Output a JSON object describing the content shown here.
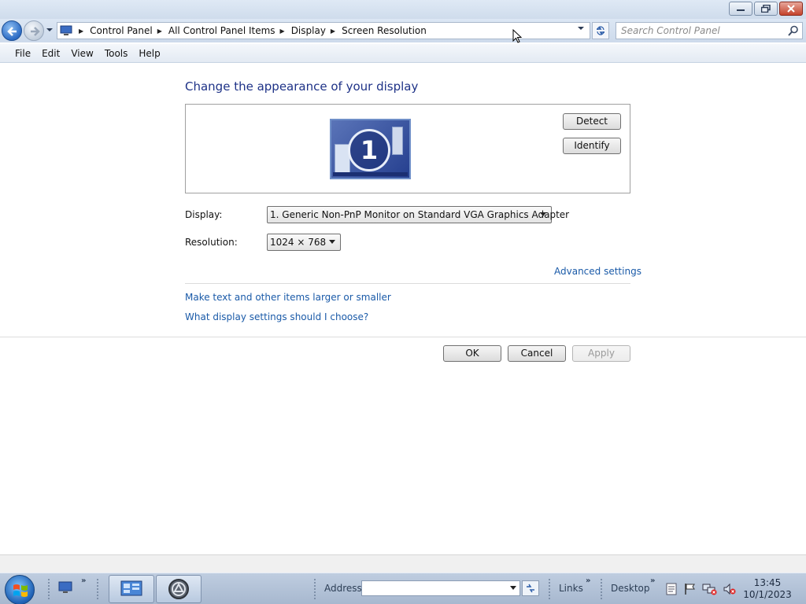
{
  "address_bar": {
    "breadcrumbs": [
      "Control Panel",
      "All Control Panel Items",
      "Display",
      "Screen Resolution"
    ],
    "search_placeholder": "Search Control Panel"
  },
  "menu": [
    "File",
    "Edit",
    "View",
    "Tools",
    "Help"
  ],
  "content": {
    "heading": "Change the appearance of your display",
    "monitor_number": "1",
    "detect_label": "Detect",
    "identify_label": "Identify",
    "display_label": "Display:",
    "display_value": "1. Generic Non-PnP Monitor on Standard VGA Graphics Adapter",
    "resolution_label": "Resolution:",
    "resolution_value": "1024 × 768",
    "advanced_link": "Advanced settings",
    "text_size_link": "Make text and other items larger or smaller",
    "help_link": "What display settings should I choose?",
    "ok_label": "OK",
    "cancel_label": "Cancel",
    "apply_label": "Apply",
    "apply_enabled": false
  },
  "taskbar": {
    "address_label": "Address",
    "address_value": "",
    "links_label": "Links",
    "desktop_label": "Desktop",
    "time": "13:45",
    "date": "10/1/2023"
  },
  "colors": {
    "heading": "#1e3287",
    "link": "#1a5aa8",
    "title_bar": "#dfe9f5",
    "close_button": "#c4432c"
  },
  "icons": [
    "back-arrow-icon",
    "forward-arrow-icon",
    "computer-icon",
    "refresh-icon",
    "search-icon",
    "minimize-icon",
    "restore-icon",
    "close-icon",
    "windows-logo-icon",
    "flag-icon",
    "network-icon",
    "volume-muted-icon"
  ]
}
